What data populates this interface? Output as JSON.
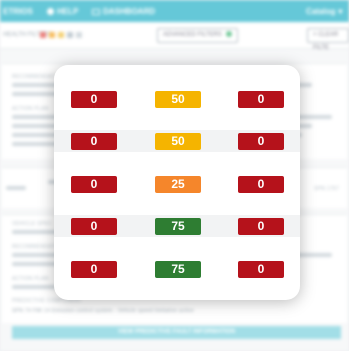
{
  "topbar": {
    "nav": [
      {
        "label": "ETRIOS",
        "icon": "document-icon"
      },
      {
        "label": "HELP",
        "icon": "help-icon"
      },
      {
        "label": "DASHBOARD",
        "icon": "dashboard-icon"
      }
    ],
    "user": "Catalog"
  },
  "filterbar": {
    "label": "HEALTH FILTERS",
    "swatches": [
      "#e5534b",
      "#f5a623",
      "#f0c040",
      "#a9b7c1",
      "#c2ccd3"
    ],
    "advanced_filters": "ADVANCED FILTERS",
    "clear_filters": "CLEAR FILTE"
  },
  "background_text": {
    "recommendation": "RECOMMENDATION",
    "action_plan": "ACTION PLAN",
    "vehicle_spec": "VEHICLE SPEC",
    "predictive_component": "PREDICTIVE COMPONENT",
    "spn_line": "SPN 74 FMI 14 Emission control system - Vehicle speed limitation active",
    "spn_code": "SPN 1767",
    "bottom_button": "VIEW PREDICTIVE FAULT INFORMATION"
  },
  "colors": {
    "red": "#b5121b",
    "yellow": "#f5b400",
    "orange": "#f5862b",
    "green": "#2e7d32"
  },
  "popup": {
    "rows": [
      {
        "left": "0",
        "middle": "50",
        "middle_color": "yellow",
        "right": "0"
      },
      {
        "left": "0",
        "middle": "50",
        "middle_color": "yellow",
        "right": "0"
      },
      {
        "left": "0",
        "middle": "25",
        "middle_color": "orange",
        "right": "0"
      },
      {
        "left": "0",
        "middle": "75",
        "middle_color": "green",
        "right": "0"
      },
      {
        "left": "0",
        "middle": "75",
        "middle_color": "green",
        "right": "0"
      }
    ]
  }
}
